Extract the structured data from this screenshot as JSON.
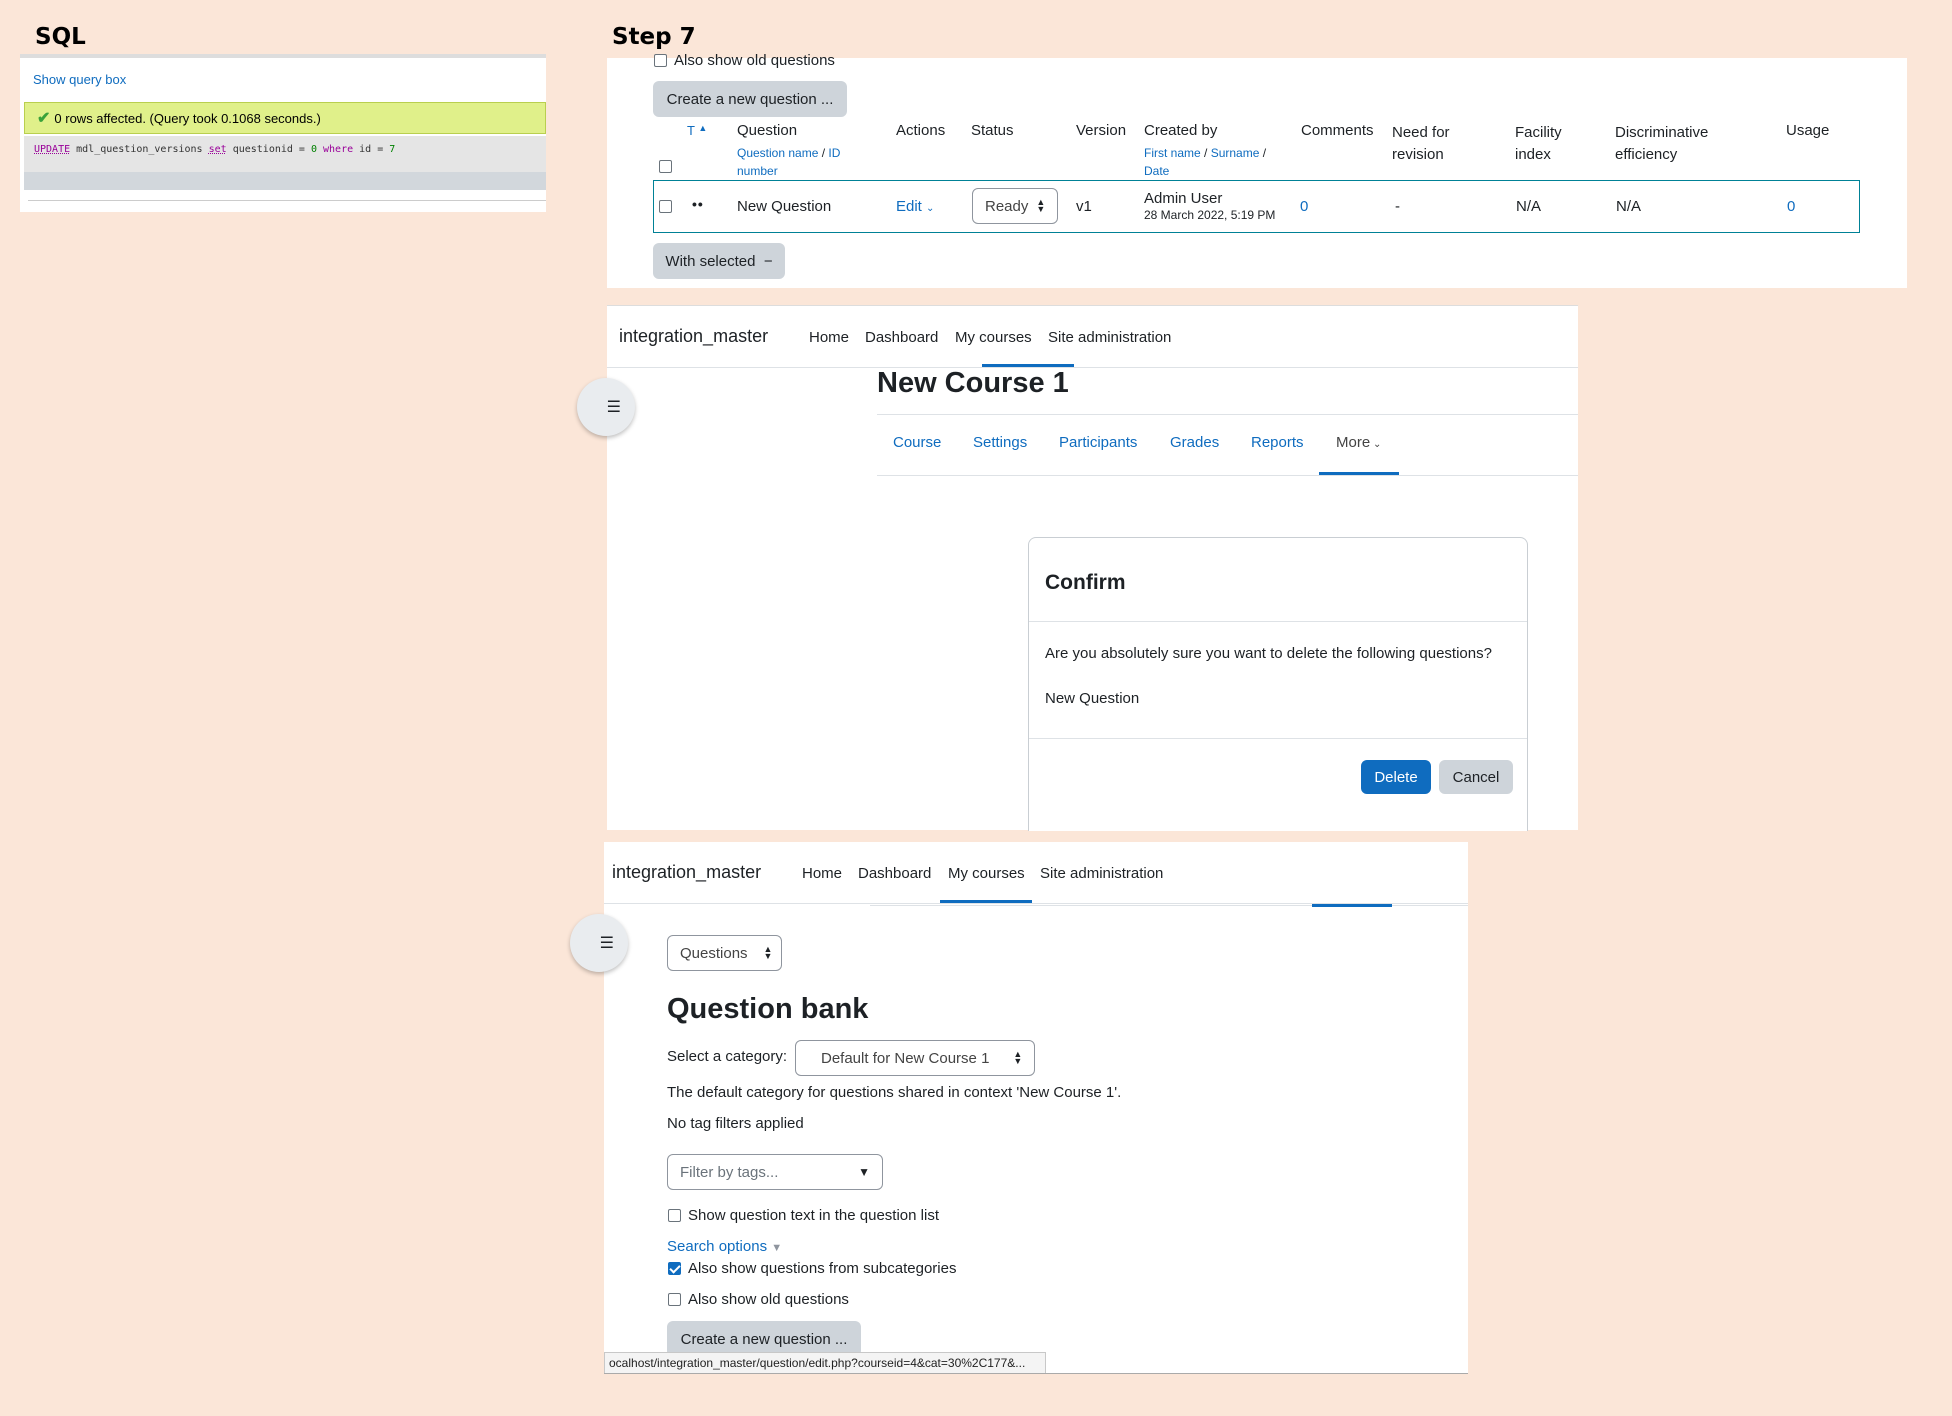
{
  "labels": {
    "sql": "SQL",
    "step": "Step 7"
  },
  "sql_panel": {
    "show_query_box": "Show query box",
    "message": "0 rows affected. (Query took 0.1068 seconds.)",
    "query": {
      "kw_update": "UPDATE",
      "table": " mdl_question_versions ",
      "kw_set": "set",
      "mid": " questionid = ",
      "val1": "0",
      "kw_where": " where",
      "end": " id = ",
      "val2": "7"
    }
  },
  "qbank_top": {
    "also_show_old": "Also show old questions",
    "create_button": "Create a new question ...",
    "headers": {
      "type": "T",
      "question": "Question",
      "question_sub_name": "Question name",
      "question_sub_id": "ID",
      "question_sub_number": "number",
      "actions": "Actions",
      "status": "Status",
      "version": "Version",
      "created_by": "Created by",
      "created_sub_first": "First name",
      "created_sub_surname": "Surname",
      "created_sub_date": "Date",
      "comments": "Comments",
      "need_for": "Need for",
      "revision": "revision",
      "facility": "Facility",
      "index": "index",
      "discriminative": "Discriminative",
      "efficiency": "efficiency",
      "usage": "Usage"
    },
    "row": {
      "name": "New Question",
      "action": "Edit",
      "status": "Ready",
      "version": "v1",
      "creator": "Admin User",
      "date": "28 March 2022, 5:19 PM",
      "comments": "0",
      "need_revision": "-",
      "facility": "N/A",
      "discriminative": "N/A",
      "usage": "0"
    },
    "with_selected": "With selected"
  },
  "navbar": {
    "site": "integration_master",
    "items": [
      "Home",
      "Dashboard",
      "My courses",
      "Site administration"
    ]
  },
  "course_page": {
    "title": "New Course 1",
    "tabs": [
      "Course",
      "Settings",
      "Participants",
      "Grades",
      "Reports",
      "More"
    ],
    "modal": {
      "title": "Confirm",
      "message": "Are you absolutely sure you want to delete the following questions?",
      "item": "New Question",
      "delete": "Delete",
      "cancel": "Cancel"
    }
  },
  "bank_page": {
    "selector": "Questions",
    "title": "Question bank",
    "category_label": "Select a category:",
    "category_value": "Default for New Course 1",
    "category_desc": "The default category for questions shared in context 'New Course 1'.",
    "no_tags": "No tag filters applied",
    "filter_placeholder": "Filter by tags...",
    "show_text": "Show question text in the question list",
    "search_options": "Search options",
    "subcategories": "Also show questions from subcategories",
    "old_questions": "Also show old questions",
    "create_button": "Create a new question ...",
    "status_url": "ocalhost/integration_master/question/edit.php?courseid=4&cat=30%2C177&..."
  },
  "colors": {
    "link": "#0f6cbf",
    "primary_button": "#0f6cbf",
    "background": "#fbe6d8",
    "success": "#e0f08a"
  }
}
